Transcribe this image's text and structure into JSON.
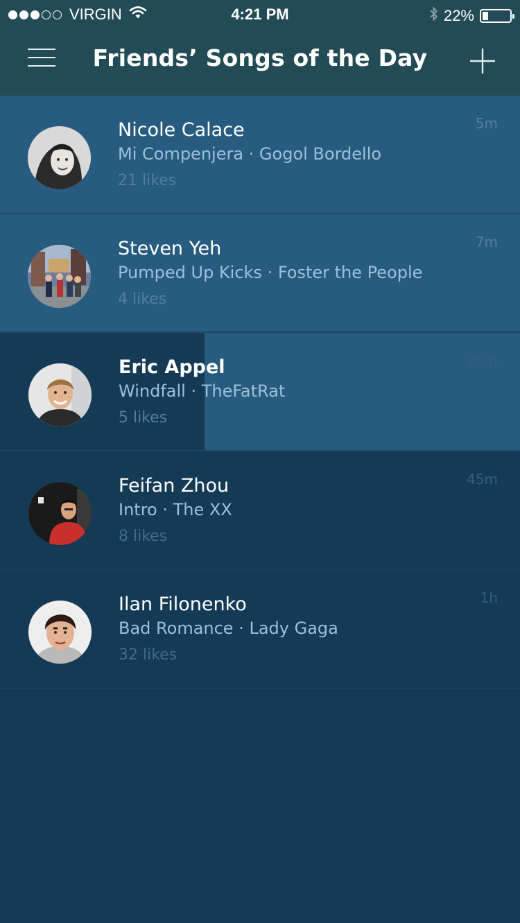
{
  "status_bar": {
    "carrier": "VIRGIN",
    "time": "4:21 PM",
    "battery_percent": "22%",
    "battery_level": 0.22,
    "signal_bars": 3,
    "signal_total": 5
  },
  "nav": {
    "title": "Friends’ Songs of the Day",
    "menu_icon": "hamburger-menu-icon",
    "add_icon": "plus-icon"
  },
  "colors": {
    "header_bg": "#234b55",
    "highlight_row": "#275c80",
    "list_bg": "#153a56",
    "song_text": "#9cc0d8",
    "likes_text": "#4f7f9f"
  },
  "feed": [
    {
      "name": "Nicole Calace",
      "song": "Mi Compenjera · Gogol Bordello",
      "likes": "21 likes",
      "time": "5m"
    },
    {
      "name": "Steven Yeh",
      "song": "Pumped Up Kicks · Foster the People",
      "likes": "4 likes",
      "time": "7m"
    },
    {
      "name": "Eric Appel",
      "song": "Windfall · TheFatRat",
      "likes": "5 likes",
      "time": "20m"
    },
    {
      "name": "Feifan Zhou",
      "song": "Intro · The XX",
      "likes": "8 likes",
      "time": "45m"
    },
    {
      "name": "Ilan Filonenko",
      "song": "Bad Romance · Lady Gaga",
      "likes": "32 likes",
      "time": "1h"
    }
  ]
}
